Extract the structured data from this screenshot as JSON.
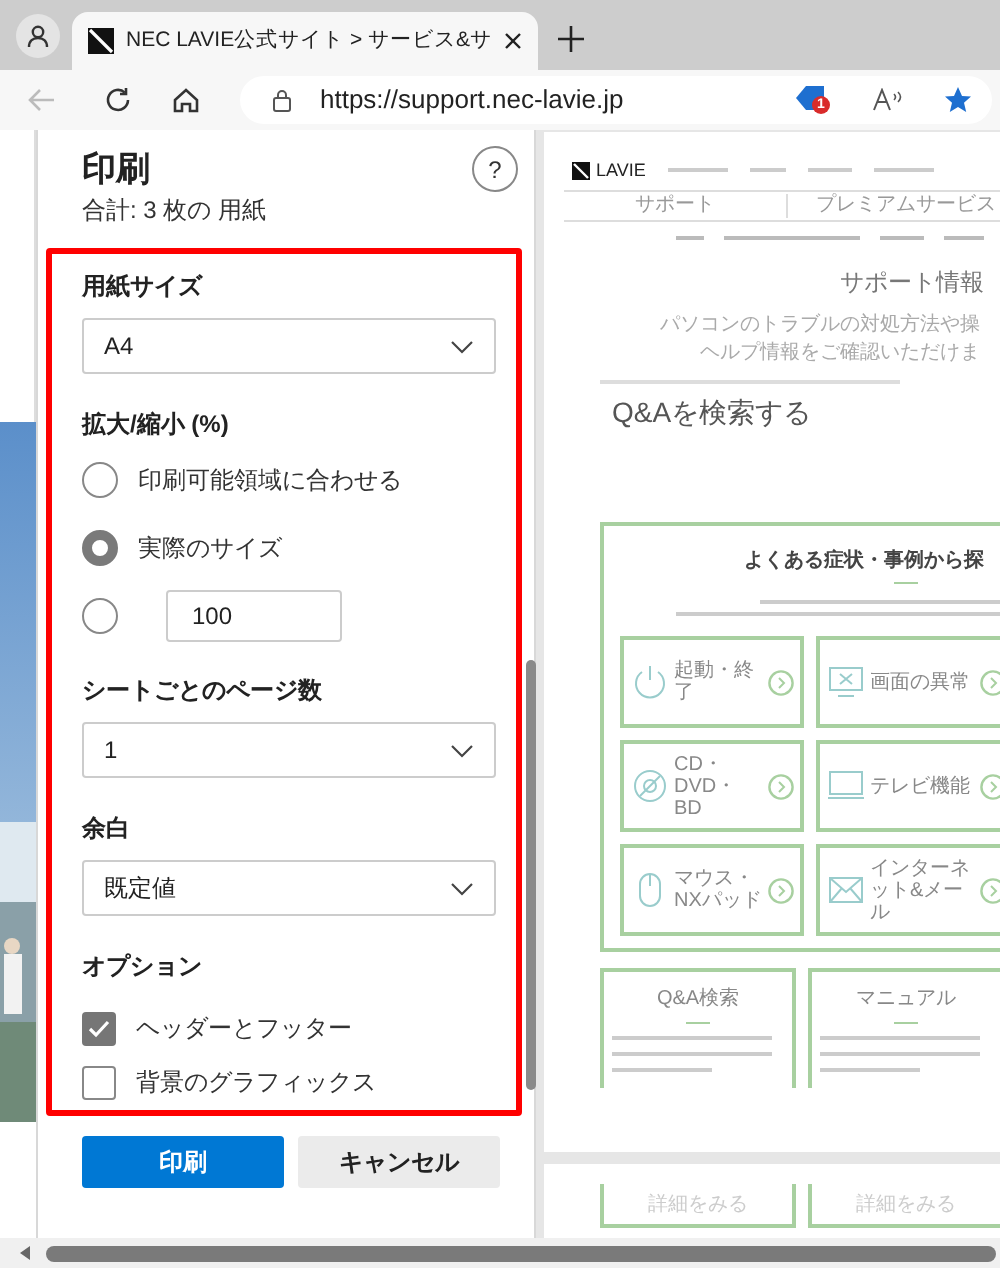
{
  "browser": {
    "tab": {
      "title": "NEC LAVIE公式サイト > サービス&サ",
      "selected": true
    },
    "url": "https://support.nec-lavie.jp",
    "collections_badge": "1"
  },
  "print_panel": {
    "title": "印刷",
    "subtitle": "合計: 3 枚の 用紙",
    "help": "?",
    "sections": [
      {
        "kind": "dropdown",
        "label": "用紙サイズ",
        "value": "A4"
      },
      {
        "kind": "radios",
        "label": "拡大/縮小 (%)",
        "options": [
          {
            "label": "印刷可能領域に合わせる",
            "selected": false
          },
          {
            "label": "実際のサイズ",
            "selected": true
          },
          {
            "value": "100",
            "selected": false
          }
        ]
      },
      {
        "kind": "dropdown",
        "label": "シートごとのページ数",
        "value": "1"
      },
      {
        "kind": "dropdown",
        "label": "余白",
        "value": "既定値"
      },
      {
        "kind": "checks",
        "label": "オプション",
        "items": [
          {
            "label": "ヘッダーとフッター",
            "checked": true
          },
          {
            "label": "背景のグラフィックス",
            "checked": false
          }
        ]
      }
    ],
    "buttons": [
      {
        "label": "印刷",
        "primary": true
      },
      {
        "label": "キャンセル",
        "primary": false
      }
    ]
  },
  "preview": {
    "logo": "LAVIE",
    "tabs": [
      "サポート",
      "プレミアムサービス"
    ],
    "heading": "サポート情報",
    "intro": [
      "パソコンのトラブルの対処方法や操",
      "ヘルプ情報をご確認いただけま"
    ],
    "search_title": "Q&Aを検索する",
    "section_title": "よくある症状・事例から探",
    "categories": [
      {
        "label": "起動・終了"
      },
      {
        "label": "画面の異常"
      },
      {
        "label": "CD・DVD・BD"
      },
      {
        "label": "テレビ機能"
      },
      {
        "label": "マウス・NXパッド"
      },
      {
        "label": "インターネット&メール"
      }
    ],
    "cards": [
      "Q&A検索",
      "マニュアル"
    ],
    "next_page": [
      "詳細をみる",
      "詳細をみる"
    ]
  }
}
